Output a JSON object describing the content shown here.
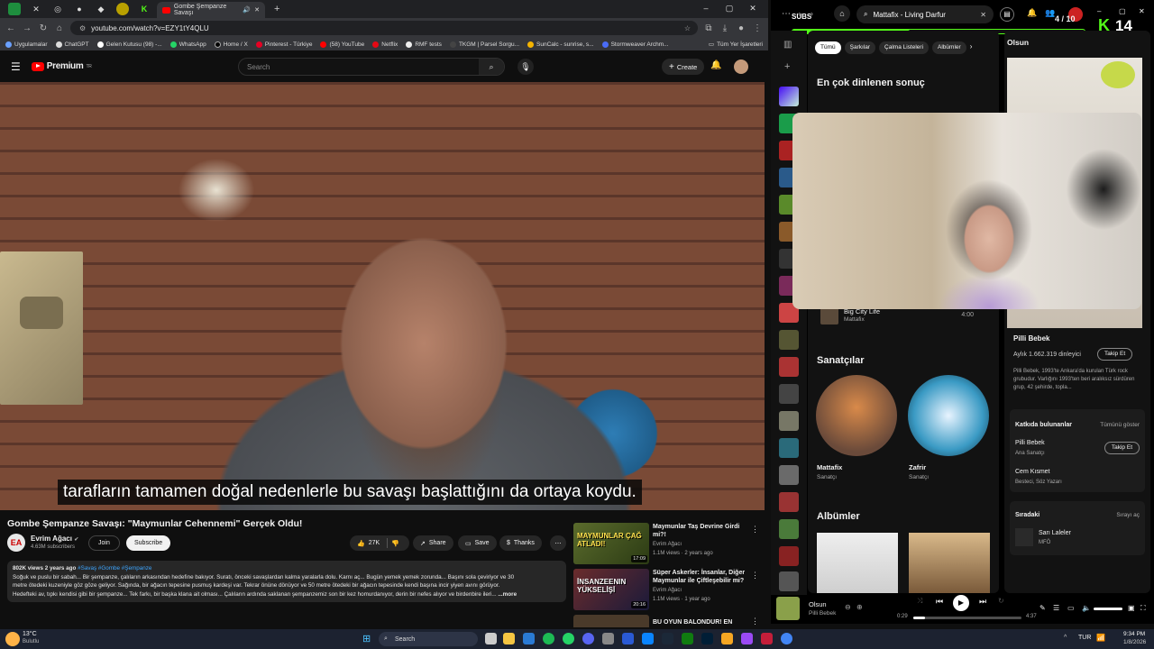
{
  "browser": {
    "active_tab": "Gombe Şempanze Savaşı",
    "url": "youtube.com/watch?v=EZY1tY4QLU",
    "bookmarks": [
      "Uygulamalar",
      "ChatGPT",
      "Gelen Kutusu (98) -...",
      "WhatsApp",
      "Home / X",
      "Pinterest - Türkiye",
      "(58) YouTube",
      "Netflix",
      "RMF tests",
      "TKGM | Parsel Sorgu...",
      "SunCalc - sunrise, s...",
      "Stormweaver Archm..."
    ],
    "all_bookmarks": "Tüm Yer İşaretleri"
  },
  "youtube": {
    "logo_text": "Premium",
    "logo_region": "TR",
    "search_placeholder": "Search",
    "create_label": "Create",
    "caption": "tarafların tamamen doğal nedenlerle bu savaşı başlattığını da ortaya koydu.",
    "video_title": "Gombe Şempanze Savaşı: \"Maymunlar Cehennemi\" Gerçek Oldu!",
    "channel": {
      "name": "Evrim Ağacı",
      "subs": "4.63M subscribers",
      "initials": "EA"
    },
    "join_label": "Join",
    "subscribe_label": "Subscribe",
    "likes": "27K",
    "share_label": "Share",
    "save_label": "Save",
    "thanks_label": "Thanks",
    "description": {
      "meta": "802K views  2 years ago",
      "tags": "#Savaş #Gombe #Şempanze",
      "line1": "Soğuk ve puslu bir sabah... Bir şempanze, çalıların arkasından hedefine bakıyor. Suratı, önceki savaşlardan kalma yaralarla dolu. Karnı aç... Bugün yemek yemek zorunda... Başını sola çeviriyor ve 30",
      "line2": "metre ötedeki kuzeniyle göz göze geliyor. Sağında, bir ağacın tepesine pusmuş kardeşi var. Tekrar önüne dönüyor ve 50 metre ötedeki bir ağacın tepesinde kendi başına incir yiyen avını görüyor.",
      "line3": "Hedefteki av, tıpkı kendisi gibi bir şempanze... Tek farkı, bir başka klana ait olması... Çalıların ardında saklanan şempanzemiz son bir kez homurdanıyor, derin bir nefes alıyor ve birdenbire ileri...",
      "more": "...more"
    },
    "recommendations": [
      {
        "title": "Maymunlar Taş Devrine Girdi mi?!",
        "channel": "Evrim Ağacı",
        "meta": "1.1M views · 2 years ago",
        "thumb_text": "MAYMUNLAR ÇAĞ ATLADI!",
        "duration": "17:09"
      },
      {
        "title": "Süper Askerler: İnsanlar, Diğer Maymunlar ile Çiftleşebilir mi?",
        "channel": "Evrim Ağacı",
        "meta": "1.1M views · 1 year ago",
        "thumb_text": "İNSANZEENIN YÜKSELİŞİ",
        "duration": "20:16"
      },
      {
        "title": "BU OYUN BALONDUR! EN",
        "channel": "",
        "meta": "",
        "thumb_text": "",
        "duration": ""
      }
    ]
  },
  "spotify": {
    "search_value": "Mattafix - Living Darfur",
    "chips": [
      "Tümü",
      "Şarkılar",
      "Çalma Listeleri",
      "Albümler"
    ],
    "top_result_heading": "En çok dinlenen sonuç",
    "song": {
      "title": "Big City Life",
      "artist": "Mattafix",
      "duration": "4:00"
    },
    "artists_heading": "Sanatçılar",
    "artists": [
      {
        "name": "Mattafix",
        "role": "Sanatçı"
      },
      {
        "name": "Zafrir",
        "role": "Sanatçı"
      }
    ],
    "albums_heading": "Albümler",
    "now_playing_panel_title": "Olsun",
    "panel_artist": "Pilli Bebek",
    "listeners": "Aylık 1.662.319 dinleyici",
    "follow_label": "Takip Et",
    "bio": "Pilli Bebek, 1993'te Ankara'da kurulan Türk rock grubudur. Varlığını 1993'ten beri aralıksız sürdüren grup, 42 şehirde, topla...",
    "contributors_heading": "Katkıda bulunanlar",
    "show_all": "Tümünü göster",
    "contributors": [
      {
        "name": "Pilli Bebek",
        "role": "Ana Sanatçı"
      },
      {
        "name": "Cem Kısmet",
        "role": "Besteci, Söz Yazarı"
      }
    ],
    "queue_heading": "Sıradaki",
    "queue_open": "Sırayı aç",
    "queue_item": {
      "title": "Sarı Laleler",
      "artist": "MFÖ"
    },
    "player": {
      "title": "Olsun",
      "artist": "Pilli Bebek",
      "elapsed": "0:29",
      "total": "4:37",
      "progress": 0.105
    }
  },
  "stream_overlay": {
    "subs_label": "SUBS",
    "subs_count": "4 / 10",
    "subs_progress": 0.4,
    "kick_count": "14"
  },
  "taskbar": {
    "weather_temp": "13°C",
    "weather_desc": "Bulutlu",
    "search_label": "Search",
    "lang": "TUR",
    "time": "9:34 PM",
    "date": "1/8/2026"
  }
}
